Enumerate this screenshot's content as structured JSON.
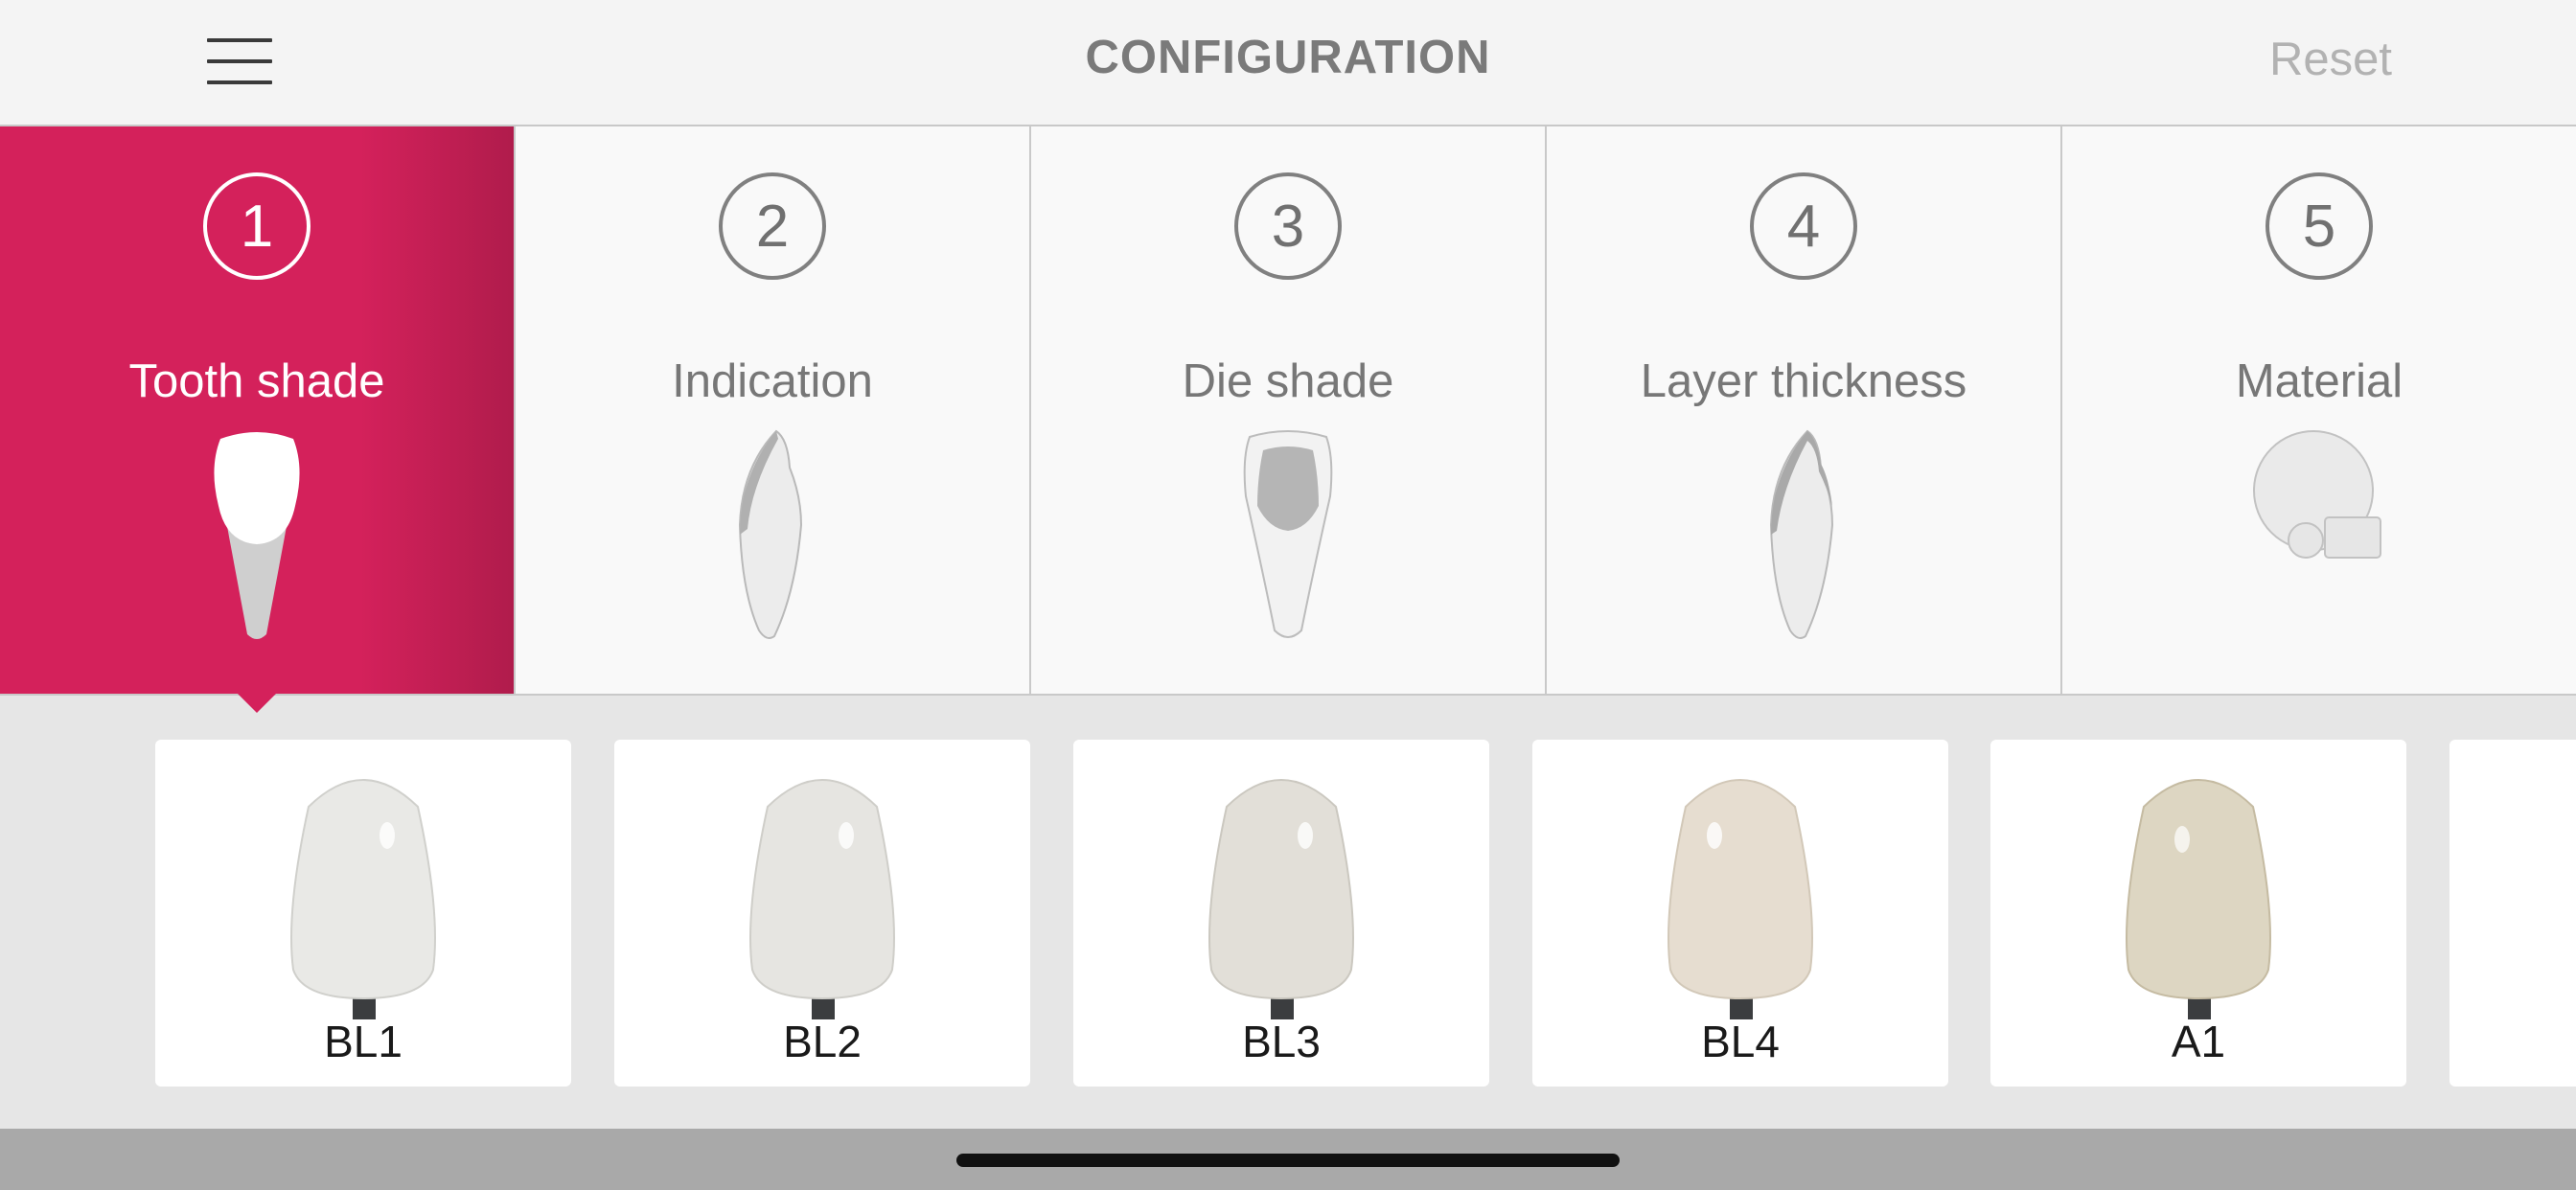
{
  "header": {
    "title": "CONFIGURATION",
    "reset_label": "Reset",
    "menu_icon": "hamburger-menu-icon"
  },
  "steps": [
    {
      "number": "1",
      "label": "Tooth shade",
      "icon": "tooth-shade-icon",
      "active": true
    },
    {
      "number": "2",
      "label": "Indication",
      "icon": "indication-icon",
      "active": false
    },
    {
      "number": "3",
      "label": "Die shade",
      "icon": "die-shade-icon",
      "active": false
    },
    {
      "number": "4",
      "label": "Layer thickness",
      "icon": "layer-thickness-icon",
      "active": false
    },
    {
      "number": "5",
      "label": "Material",
      "icon": "material-icon",
      "active": false
    }
  ],
  "shades": [
    {
      "label": "BL1",
      "color": "#e9e9e6"
    },
    {
      "label": "BL2",
      "color": "#e6e5e1"
    },
    {
      "label": "BL3",
      "color": "#e2dfd8"
    },
    {
      "label": "BL4",
      "color": "#e6ddd0"
    },
    {
      "label": "A1",
      "color": "#ddd6c2"
    }
  ],
  "colors": {
    "accent": "#d4215b",
    "header_bg": "#f4f4f4",
    "page_bg": "#e6e6e6"
  }
}
